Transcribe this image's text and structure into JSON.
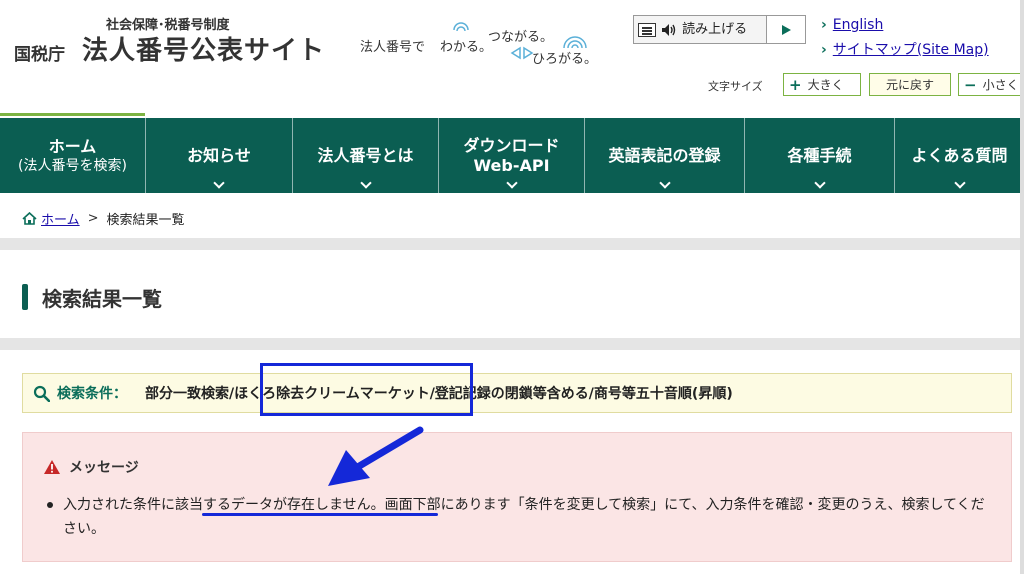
{
  "header": {
    "logo_subtitle": "社会保障･税番号制度",
    "logo_agency": "国税庁",
    "logo_main": "法人番号公表サイト",
    "tagline": {
      "prefix": "法人番号で",
      "w1": "わかる。",
      "w2": "つながる。",
      "w3": "ひろがる。"
    },
    "speech_label": "読み上げる",
    "links": {
      "english": "English",
      "sitemap": "サイトマップ(Site Map)"
    },
    "font_size": {
      "label": "文字サイズ",
      "larger": "大きく",
      "reset": "元に戻す",
      "smaller": "小さく"
    }
  },
  "nav": [
    {
      "l1": "ホーム",
      "l2": "(法人番号を検索)",
      "chevron": false
    },
    {
      "l1": "お知らせ",
      "l2": "",
      "chevron": true
    },
    {
      "l1": "法人番号とは",
      "l2": "",
      "chevron": true
    },
    {
      "l1": "ダウンロード",
      "l2": "Web-API",
      "chevron": true
    },
    {
      "l1": "英語表記の登録",
      "l2": "",
      "chevron": true
    },
    {
      "l1": "各種手続",
      "l2": "",
      "chevron": true
    },
    {
      "l1": "よくある質問",
      "l2": "",
      "chevron": true
    }
  ],
  "breadcrumb": {
    "home": "ホーム",
    "separator": ">",
    "current": "検索結果一覧"
  },
  "page_title": "検索結果一覧",
  "search_conditions": {
    "label": "検索条件：",
    "value": "部分一致検索/ほくろ除去クリームマーケット/登記記録の閉鎖等含める/商号等五十音順(昇順)"
  },
  "message": {
    "title": "メッセージ",
    "text_before": "入力された条件に",
    "text_highlight": "該当するデータが存在しません。",
    "text_after": "画面下部にあります「条件を変更して検索」にて、入力条件を確認・変更のうえ、検索してください。"
  },
  "colors": {
    "nav_bg": "#0b5e52",
    "accent_green": "#7cb342",
    "annotation_blue": "#1428d8",
    "message_bg": "#fbe5e5",
    "condition_bg": "#fdfbe3"
  }
}
